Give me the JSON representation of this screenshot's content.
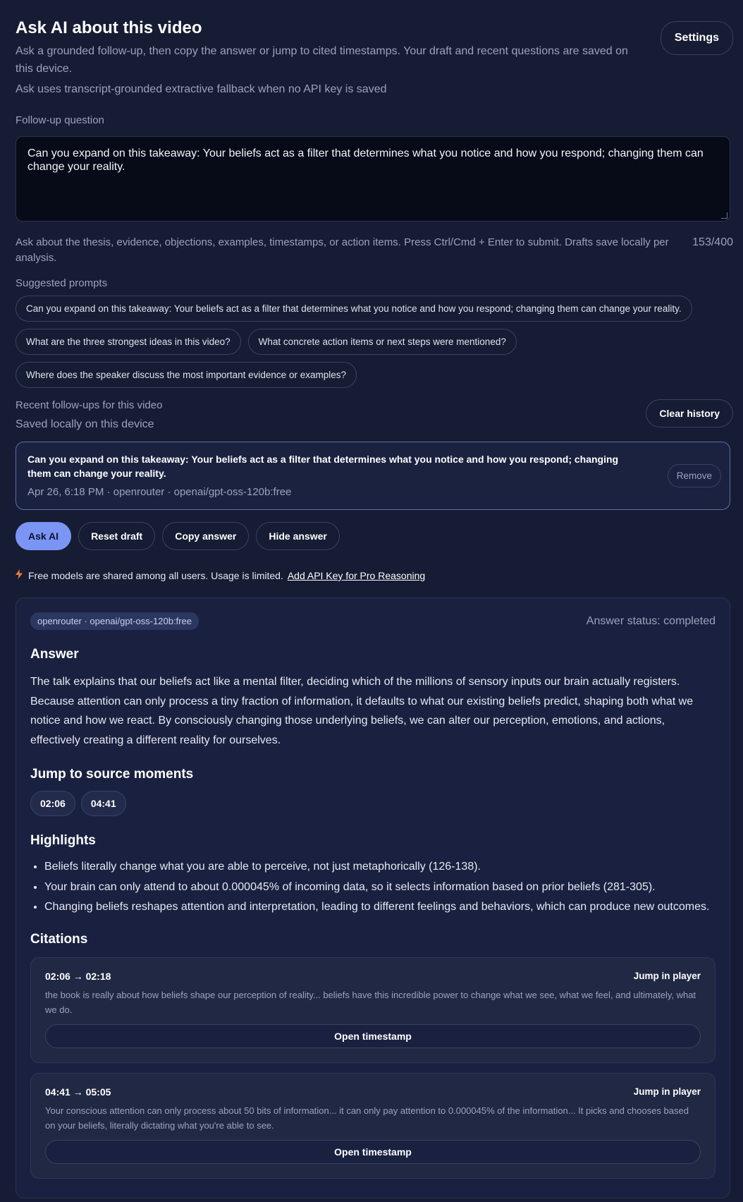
{
  "header": {
    "title": "Ask AI about this video",
    "subtitle": "Ask a grounded follow-up, then copy the answer or jump to cited timestamps. Your draft and recent questions are saved on this device.",
    "mode_note": "Ask uses transcript-grounded extractive fallback when no API key is saved",
    "settings_label": "Settings"
  },
  "question": {
    "label": "Follow-up question",
    "value": "Can you expand on this takeaway: Your beliefs act as a filter that determines what you notice and how you respond; changing them can change your reality.",
    "help": "Ask about the thesis, evidence, objections, examples, timestamps, or action items. Press Ctrl/Cmd + Enter to submit. Drafts save locally per analysis.",
    "char_count": "153/400"
  },
  "suggested": {
    "label": "Suggested prompts",
    "prompts": [
      "Can you expand on this takeaway: Your beliefs act as a filter that determines what you notice and how you respond; changing them can change your reality.",
      "What are the three strongest ideas in this video?",
      "What concrete action items or next steps were mentioned?",
      "Where does the speaker discuss the most important evidence or examples?"
    ]
  },
  "history": {
    "title": "Recent follow-ups for this video",
    "subtitle": "Saved locally on this device",
    "clear_label": "Clear history",
    "items": [
      {
        "question": "Can you expand on this takeaway: Your beliefs act as a filter that determines what you notice and how you respond; changing them can change your reality.",
        "meta": "Apr 26, 6:18 PM · openrouter · openai/gpt-oss-120b:free",
        "remove_label": "Remove"
      }
    ]
  },
  "actions": {
    "ask": "Ask AI",
    "reset": "Reset draft",
    "copy": "Copy answer",
    "hide": "Hide answer"
  },
  "notice": {
    "icon": "lightning-icon",
    "text": "Free models are shared among all users. Usage is limited.",
    "link": "Add API Key for Pro Reasoning"
  },
  "answer": {
    "model_badge": "openrouter · openai/gpt-oss-120b:free",
    "status": "Answer status: completed",
    "heading": "Answer",
    "text": "The talk explains that our beliefs act like a mental filter, deciding which of the millions of sensory inputs our brain actually registers. Because attention can only process a tiny fraction of information, it defaults to what our existing beliefs predict, shaping both what we notice and how we react. By consciously changing those underlying beliefs, we can alter our perception, emotions, and actions, effectively creating a different reality for ourselves.",
    "jump_heading": "Jump to source moments",
    "timestamps": [
      "02:06",
      "04:41"
    ],
    "highlights_heading": "Highlights",
    "highlights": [
      "Beliefs literally change what you are able to perceive, not just metaphorically (126-138).",
      "Your brain can only attend to about 0.000045% of incoming data, so it selects information based on prior beliefs (281-305).",
      "Changing beliefs reshapes attention and interpretation, leading to different feelings and behaviors, which can produce new outcomes."
    ],
    "citations_heading": "Citations",
    "citations": [
      {
        "range": "02:06 → 02:18",
        "jump_label": "Jump in player",
        "text": "the book is really about how beliefs shape our perception of reality... beliefs have this incredible power to change what we see, what we feel, and ultimately, what we do.",
        "open_label": "Open timestamp"
      },
      {
        "range": "04:41 → 05:05",
        "jump_label": "Jump in player",
        "text": "Your conscious attention can only process about 50 bits of information... it can only pay attention to 0.000045% of the information... It picks and chooses based on your beliefs, literally dictating what you're able to see.",
        "open_label": "Open timestamp"
      }
    ]
  }
}
